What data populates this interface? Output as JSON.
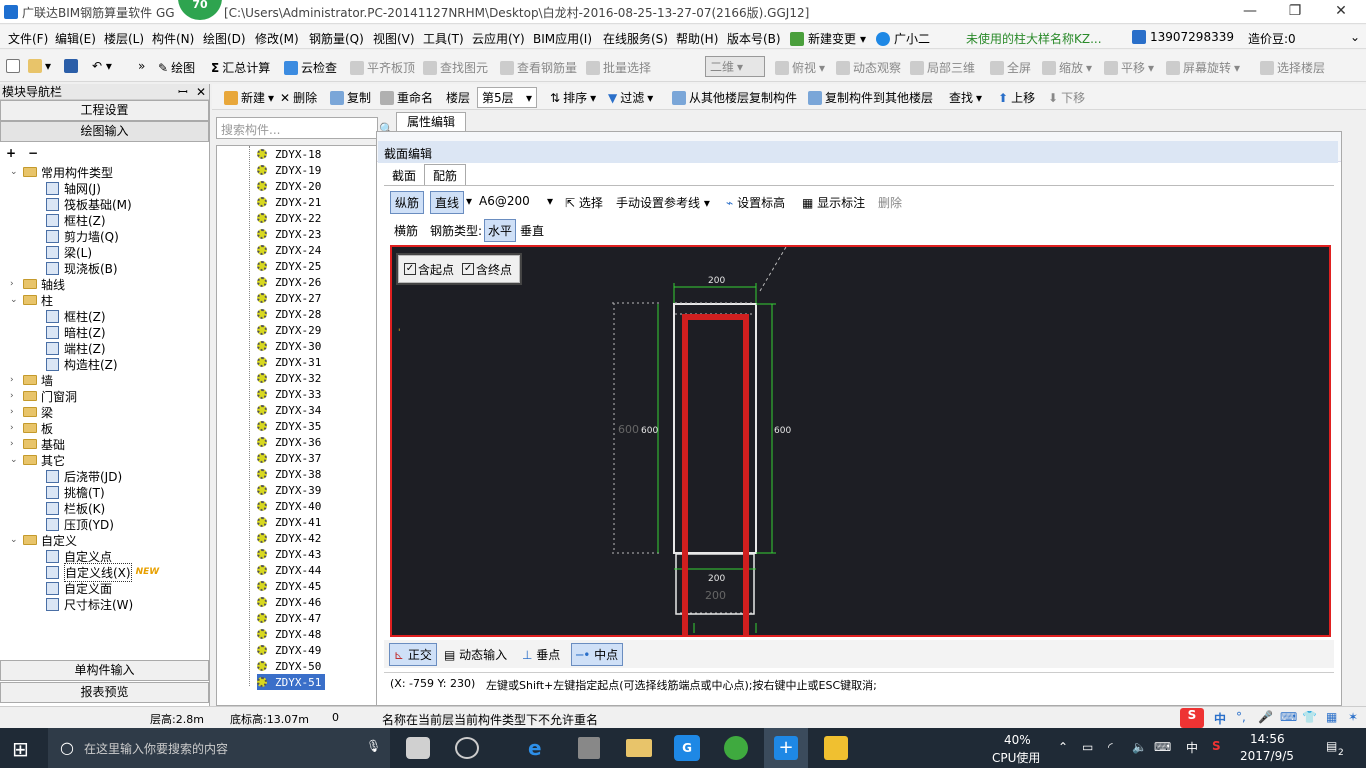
{
  "titlebar": {
    "app_name": "广联达BIM钢筋算量软件 GG",
    "badge": "70",
    "path": "[C:\\Users\\Administrator.PC-20141127NRHM\\Desktop\\白龙村-2016-08-25-13-27-07(2166版).GGJ12]"
  },
  "menu": [
    "文件(F)",
    "编辑(E)",
    "楼层(L)",
    "构件(N)",
    "绘图(D)",
    "修改(M)",
    "钢筋量(Q)",
    "视图(V)",
    "工具(T)",
    "云应用(Y)",
    "BIM应用(I)",
    "在线服务(S)",
    "帮助(H)",
    "版本号(B)",
    "新建变更",
    "广小二"
  ],
  "menu_right": {
    "notice": "未使用的柱大样名称KZ...",
    "phone": "13907298339",
    "price": "造价豆:0"
  },
  "toolbar1": [
    "绘图",
    "汇总计算",
    "云检查",
    "平齐板顶",
    "查找图元",
    "查看钢筋量",
    "批量选择",
    "二维",
    "俯视",
    "动态观察",
    "局部三维",
    "全屏",
    "缩放",
    "平移",
    "屏幕旋转",
    "选择楼层"
  ],
  "toolbar2": [
    "新建",
    "删除",
    "复制",
    "重命名",
    "楼层",
    "第5层",
    "排序",
    "过滤",
    "从其他楼层复制构件",
    "复制构件到其他楼层",
    "查找",
    "上移",
    "下移"
  ],
  "nav": {
    "title": "模块导航栏",
    "btn_top1": "工程设置",
    "btn_top2": "绘图输入",
    "btn_bottom1": "单构件输入",
    "btn_bottom2": "报表预览",
    "tree": [
      {
        "level": 0,
        "type": "folder",
        "label": "常用构件类型",
        "open": true
      },
      {
        "level": 1,
        "type": "item",
        "label": "轴网(J)"
      },
      {
        "level": 1,
        "type": "item",
        "label": "筏板基础(M)"
      },
      {
        "level": 1,
        "type": "item",
        "label": "框柱(Z)"
      },
      {
        "level": 1,
        "type": "item",
        "label": "剪力墙(Q)"
      },
      {
        "level": 1,
        "type": "item",
        "label": "梁(L)"
      },
      {
        "level": 1,
        "type": "item",
        "label": "现浇板(B)"
      },
      {
        "level": 0,
        "type": "folder",
        "label": "轴线",
        "open": false
      },
      {
        "level": 0,
        "type": "folder",
        "label": "柱",
        "open": true
      },
      {
        "level": 1,
        "type": "item",
        "label": "框柱(Z)"
      },
      {
        "level": 1,
        "type": "item",
        "label": "暗柱(Z)"
      },
      {
        "level": 1,
        "type": "item",
        "label": "端柱(Z)"
      },
      {
        "level": 1,
        "type": "item",
        "label": "构造柱(Z)"
      },
      {
        "level": 0,
        "type": "folder",
        "label": "墙",
        "open": false
      },
      {
        "level": 0,
        "type": "folder",
        "label": "门窗洞",
        "open": false
      },
      {
        "level": 0,
        "type": "folder",
        "label": "梁",
        "open": false
      },
      {
        "level": 0,
        "type": "folder",
        "label": "板",
        "open": false
      },
      {
        "level": 0,
        "type": "folder",
        "label": "基础",
        "open": false
      },
      {
        "level": 0,
        "type": "folder",
        "label": "其它",
        "open": true
      },
      {
        "level": 1,
        "type": "item",
        "label": "后浇带(JD)"
      },
      {
        "level": 1,
        "type": "item",
        "label": "挑檐(T)"
      },
      {
        "level": 1,
        "type": "item",
        "label": "栏板(K)"
      },
      {
        "level": 1,
        "type": "item",
        "label": "压顶(YD)"
      },
      {
        "level": 0,
        "type": "folder",
        "label": "自定义",
        "open": true
      },
      {
        "level": 1,
        "type": "item",
        "label": "自定义点"
      },
      {
        "level": 1,
        "type": "item",
        "label": "自定义线(X)",
        "badge": "NEW"
      },
      {
        "level": 1,
        "type": "item",
        "label": "自定义面"
      },
      {
        "level": 1,
        "type": "item",
        "label": "尺寸标注(W)"
      }
    ]
  },
  "search": {
    "placeholder": "搜索构件..."
  },
  "components": [
    "ZDYX-18",
    "ZDYX-19",
    "ZDYX-20",
    "ZDYX-21",
    "ZDYX-22",
    "ZDYX-23",
    "ZDYX-24",
    "ZDYX-25",
    "ZDYX-26",
    "ZDYX-27",
    "ZDYX-28",
    "ZDYX-29",
    "ZDYX-30",
    "ZDYX-31",
    "ZDYX-32",
    "ZDYX-33",
    "ZDYX-34",
    "ZDYX-35",
    "ZDYX-36",
    "ZDYX-37",
    "ZDYX-38",
    "ZDYX-39",
    "ZDYX-40",
    "ZDYX-41",
    "ZDYX-42",
    "ZDYX-43",
    "ZDYX-44",
    "ZDYX-45",
    "ZDYX-46",
    "ZDYX-47",
    "ZDYX-48",
    "ZDYX-49",
    "ZDYX-50",
    "ZDYX-51"
  ],
  "selected_component": "ZDYX-51",
  "editor": {
    "prop_tab": "属性编辑",
    "section_title": "截面编辑",
    "tabs": [
      "截面",
      "配筋"
    ],
    "active_tab": "配筋",
    "row1": {
      "vertical": "纵筋",
      "line": "直线",
      "spec": "A6@200",
      "select": "选择",
      "manual_ref": "手动设置参考线",
      "set_elev": "设置标高",
      "show_label": "显示标注",
      "delete": "删除"
    },
    "row2": {
      "horizontal_bar": "横筋",
      "bar_type": "钢筋类型:",
      "horizontal": "水平",
      "vertical": "垂直"
    },
    "checks": [
      {
        "label": "含起点",
        "checked": true
      },
      {
        "label": "含终点",
        "checked": true
      }
    ],
    "dims": {
      "top": "200",
      "left_inner": "600",
      "left_outer": "600",
      "right": "600",
      "bottom": "200",
      "bottom_ghost": "200"
    },
    "snap": [
      "正交",
      "动态输入",
      "垂点",
      "中点"
    ],
    "coord": "(X: -759 Y: 230)",
    "hint": "左键或Shift+左键指定起点(可选择线筋端点或中心点);按右键中止或ESC键取消;"
  },
  "status": {
    "floor_h": "层高:2.8m",
    "base_h": "底标高:13.07m",
    "count": "0",
    "msg": "名称在当前层当前构件类型下不允许重名"
  },
  "ime": {
    "lang": "中"
  },
  "taskbar": {
    "search": "在这里输入你要搜索的内容",
    "cpu_pct": "40%",
    "cpu_label": "CPU使用",
    "ime": "中",
    "time": "14:56",
    "date": "2017/9/5",
    "notif": "2"
  },
  "colors": {
    "canvas_bg": "#1d1e24",
    "rebar": "#d01f1f",
    "dim_line": "#35d035",
    "frame": "#e02020",
    "selection": "#3a6fc9"
  }
}
